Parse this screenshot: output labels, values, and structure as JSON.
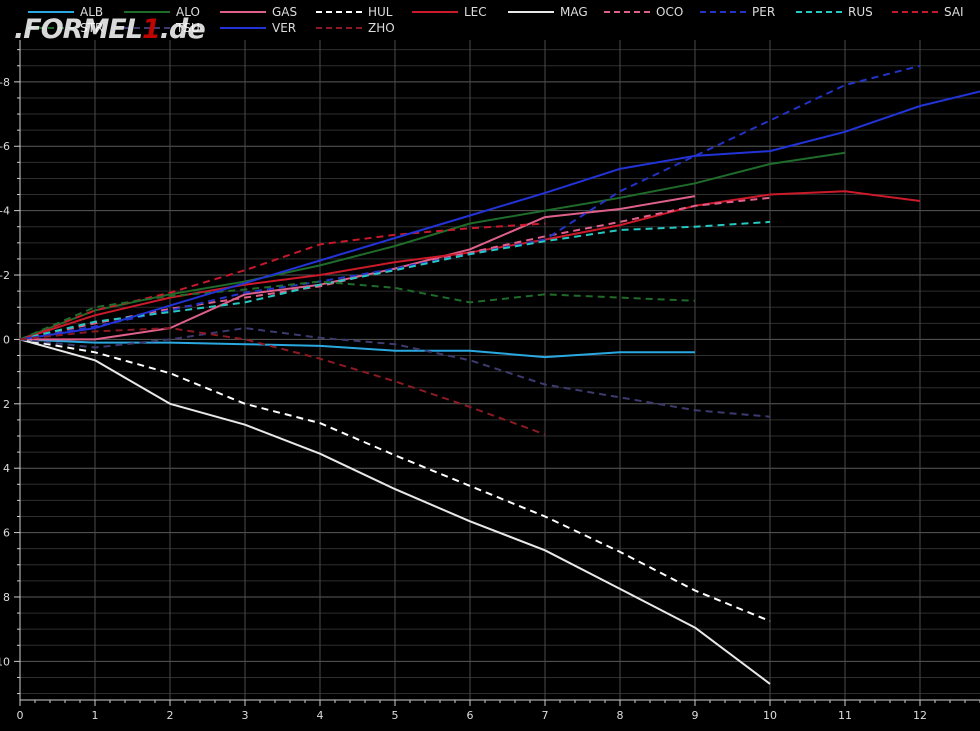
{
  "chart_data": {
    "type": "line",
    "title": "",
    "xlabel": "",
    "ylabel": "",
    "xlim": [
      0,
      12.8
    ],
    "ylim": [
      11.2,
      -9.3
    ],
    "y_axis_inverted": true,
    "grid": true,
    "background": "#000000",
    "x_ticks": [
      0,
      1,
      2,
      3,
      4,
      5,
      6,
      7,
      8,
      9,
      10,
      11,
      12
    ],
    "y_ticks": [
      -8,
      -6,
      -4,
      -2,
      0,
      2,
      4,
      6,
      8,
      10
    ],
    "y_tick_labels": [
      "-8",
      "-6",
      "-4",
      "-2",
      "0",
      "2",
      "4",
      "6",
      "8",
      "10"
    ],
    "legend_position": "top",
    "series": [
      {
        "name": "ALB",
        "color": "#2aa8e0",
        "dash": "solid",
        "x": [
          0,
          1,
          2,
          3,
          4,
          5,
          6,
          7,
          8,
          9
        ],
        "y": [
          0,
          0.1,
          0.1,
          0.15,
          0.2,
          0.35,
          0.35,
          0.55,
          0.4,
          0.4
        ]
      },
      {
        "name": "ALO",
        "color": "#1f6b2a",
        "dash": "solid",
        "x": [
          0,
          1,
          2,
          3,
          4,
          5,
          6,
          7,
          8,
          9,
          10,
          11
        ],
        "y": [
          0,
          -0.9,
          -1.4,
          -1.8,
          -2.3,
          -2.9,
          -3.6,
          -4.0,
          -4.4,
          -4.85,
          -5.45,
          -5.8
        ]
      },
      {
        "name": "GAS",
        "color": "#e0608c",
        "dash": "solid",
        "x": [
          0,
          1,
          2,
          3,
          4,
          5,
          6,
          7,
          8,
          9
        ],
        "y": [
          0,
          0,
          -0.35,
          -1.4,
          -1.7,
          -2.2,
          -2.8,
          -3.8,
          -4.05,
          -4.45
        ]
      },
      {
        "name": "HUL",
        "color": "#ffffff",
        "dash": "dashed",
        "x": [
          0,
          1,
          2,
          3,
          4,
          5,
          6,
          7,
          8,
          9,
          10
        ],
        "y": [
          0,
          0.4,
          1.05,
          2.0,
          2.6,
          3.6,
          4.55,
          5.5,
          6.6,
          7.8,
          8.75
        ]
      },
      {
        "name": "LEC",
        "color": "#cc1a2a",
        "dash": "solid",
        "x": [
          0,
          1,
          2,
          3,
          4,
          5,
          6,
          7,
          8,
          9,
          10,
          11,
          12
        ],
        "y": [
          0,
          -0.75,
          -1.3,
          -1.7,
          -2.0,
          -2.4,
          -2.7,
          -3.1,
          -3.55,
          -4.15,
          -4.5,
          -4.6,
          -4.3
        ]
      },
      {
        "name": "MAG",
        "color": "#e8e8e8",
        "dash": "solid",
        "x": [
          0,
          1,
          2,
          3,
          4,
          5,
          6,
          7,
          8,
          9,
          10
        ],
        "y": [
          0,
          0.65,
          2.0,
          2.65,
          3.55,
          4.65,
          5.65,
          6.55,
          7.75,
          8.95,
          10.7
        ]
      },
      {
        "name": "OCO",
        "color": "#e0608c",
        "dash": "dashed",
        "x": [
          0,
          1,
          2,
          3,
          4,
          5,
          6,
          7,
          8,
          9,
          10
        ],
        "y": [
          0,
          -0.5,
          -0.95,
          -1.3,
          -1.65,
          -2.2,
          -2.7,
          -3.2,
          -3.65,
          -4.15,
          -4.4
        ]
      },
      {
        "name": "PER",
        "color": "#2233c8",
        "dash": "dashed",
        "x": [
          0,
          1,
          2,
          3,
          4,
          5,
          6,
          7,
          8,
          9,
          10,
          11,
          12
        ],
        "y": [
          0,
          -0.4,
          -0.9,
          -1.45,
          -1.8,
          -2.2,
          -2.65,
          -3.1,
          -4.6,
          -5.7,
          -6.8,
          -7.9,
          -8.5
        ]
      },
      {
        "name": "RUS",
        "color": "#26c9c1",
        "dash": "dashed",
        "x": [
          0,
          1,
          2,
          3,
          4,
          5,
          6,
          7,
          8,
          9,
          10
        ],
        "y": [
          0,
          -0.55,
          -0.85,
          -1.15,
          -1.7,
          -2.15,
          -2.65,
          -3.05,
          -3.4,
          -3.5,
          -3.65
        ]
      },
      {
        "name": "SAI",
        "color": "#c8182c",
        "dash": "dashed",
        "x": [
          0,
          1,
          2,
          3,
          4,
          5,
          6,
          7
        ],
        "y": [
          0,
          -0.9,
          -1.45,
          -2.15,
          -2.95,
          -3.25,
          -3.45,
          -3.6
        ]
      },
      {
        "name": "STR",
        "color": "#1f6b2a",
        "dash": "dashed",
        "x": [
          0,
          1,
          2,
          3,
          4,
          5,
          6,
          7,
          8,
          9
        ],
        "y": [
          0,
          -1.0,
          -1.35,
          -1.55,
          -1.8,
          -1.6,
          -1.15,
          -1.4,
          -1.3,
          -1.2
        ]
      },
      {
        "name": "TSU",
        "color": "#3c3a6e",
        "dash": "dashed",
        "x": [
          0,
          1,
          2,
          3,
          4,
          5,
          6,
          7,
          8,
          9,
          10
        ],
        "y": [
          0,
          0.25,
          0,
          -0.35,
          -0.05,
          0.15,
          0.65,
          1.4,
          1.8,
          2.2,
          2.4
        ]
      },
      {
        "name": "VER",
        "color": "#2233d8",
        "dash": "solid",
        "x": [
          0,
          1,
          2,
          3,
          4,
          5,
          6,
          7,
          8,
          9,
          10,
          11,
          12,
          12.8
        ],
        "y": [
          0,
          -0.35,
          -1.05,
          -1.75,
          -2.45,
          -3.15,
          -3.85,
          -4.55,
          -5.3,
          -5.7,
          -5.85,
          -6.45,
          -7.25,
          -7.7
        ]
      },
      {
        "name": "ZHO",
        "color": "#8c1a24",
        "dash": "dashed",
        "x": [
          0,
          1,
          2,
          3,
          4,
          5,
          6,
          7
        ],
        "y": [
          0,
          -0.25,
          -0.35,
          0,
          0.6,
          1.3,
          2.1,
          2.95
        ]
      }
    ]
  },
  "watermark": {
    "part1": ".FORMEL",
    "part2": "1",
    "part3": ".de"
  }
}
